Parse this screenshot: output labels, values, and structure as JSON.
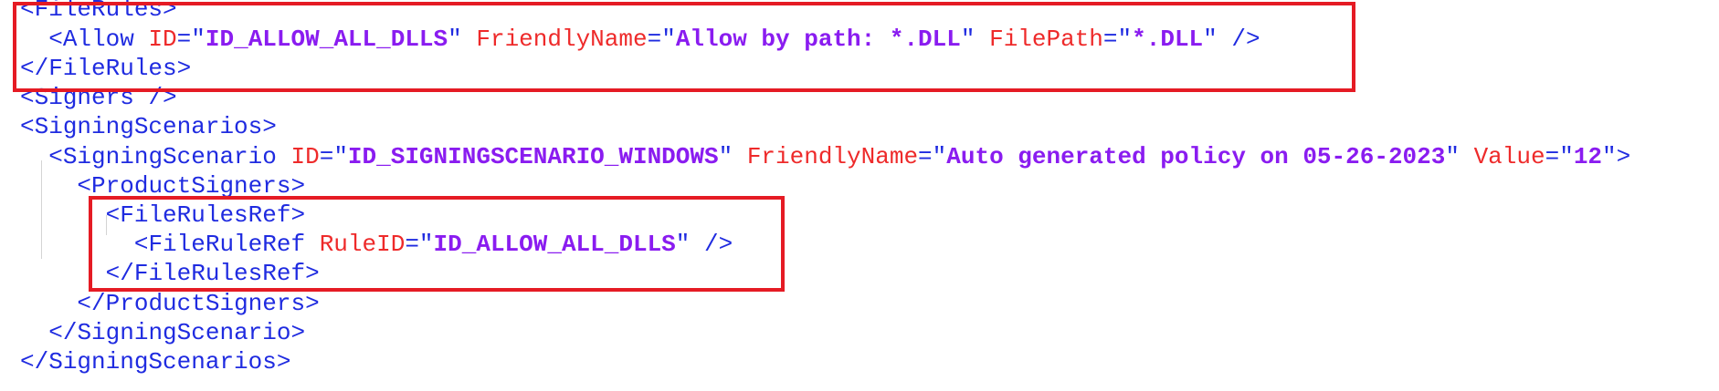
{
  "editor": {
    "lines": [
      {
        "text": "<FileRules>"
      },
      {
        "text": "  <Allow ID=\"ID_ALLOW_ALL_DLLS\" FriendlyName=\"Allow by path: *.DLL\" FilePath=\"*.DLL\" />"
      },
      {
        "text": "</FileRules>"
      },
      {
        "text": "<Signers />"
      },
      {
        "text": "<SigningScenarios>"
      },
      {
        "text": "  <SigningScenario ID=\"ID_SIGNINGSCENARIO_WINDOWS\" FriendlyName=\"Auto generated policy on 05-26-2023\" Value=\"12\">"
      },
      {
        "text": "    <ProductSigners>"
      },
      {
        "text": "      <FileRulesRef>"
      },
      {
        "text": "        <FileRuleRef RuleID=\"ID_ALLOW_ALL_DLLS\" />"
      },
      {
        "text": "      </FileRulesRef>"
      },
      {
        "text": "    </ProductSigners>"
      },
      {
        "text": "  </SigningScenario>"
      },
      {
        "text": "</SigningScenarios>"
      }
    ]
  },
  "colors": {
    "tag": "#1f2be0",
    "attribute": "#ee2a2a",
    "value": "#8a1cf0",
    "highlight_border": "#e51b24",
    "indent_guide": "#d4d4d4"
  },
  "highlights": [
    {
      "label": "filerules-box"
    },
    {
      "label": "filerulesref-box"
    }
  ]
}
